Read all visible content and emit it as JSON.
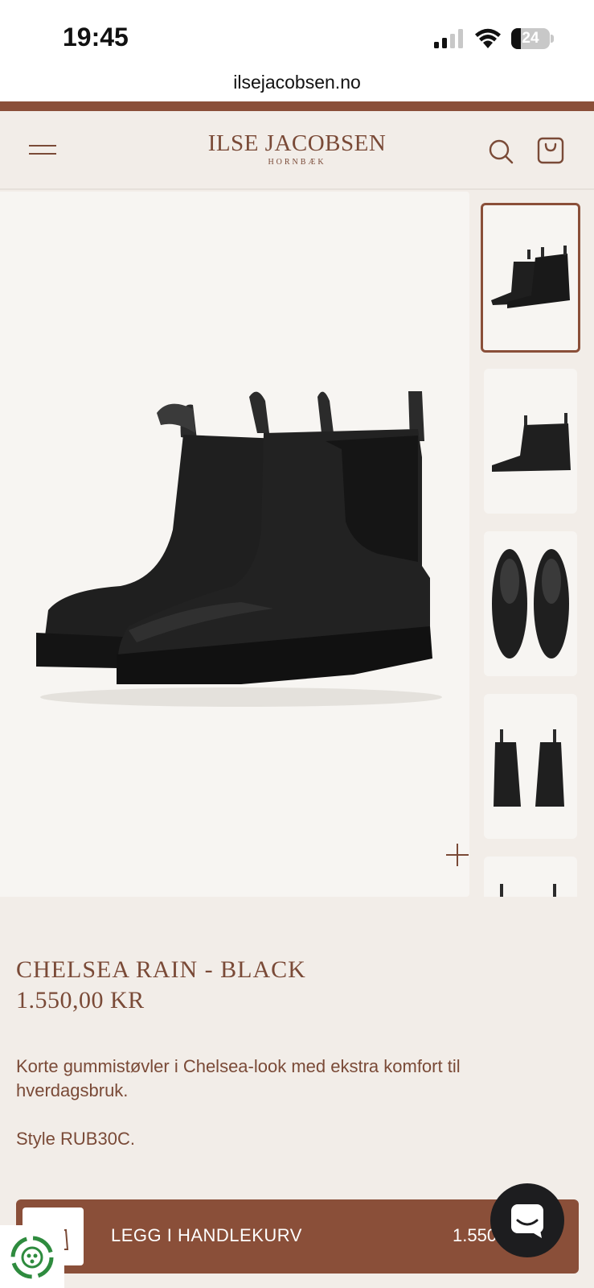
{
  "status_bar": {
    "time": "19:45",
    "battery_level": "24",
    "battery_fraction": 0.24,
    "icons": [
      "signal-icon",
      "wifi-icon",
      "battery-icon"
    ]
  },
  "browser": {
    "url": "ilsejacobsen.no"
  },
  "header": {
    "brand_name": "ILSE JACOBSEN",
    "brand_location": "HORNBÆK",
    "icons": [
      "menu-icon",
      "search-icon",
      "bag-icon"
    ]
  },
  "gallery": {
    "main_image_alt": "Chelsea Rain black rubber boots",
    "thumbnail_count": 5,
    "active_thumbnail": 1
  },
  "product": {
    "title": "CHELSEA RAIN - BLACK",
    "price": "1.550,00 KR",
    "description": "Korte gummistøvler i Chelsea-look med ekstra komfort til hverdagsbruk.",
    "style": "Style RUB30C."
  },
  "add_to_cart": {
    "label": "LEGG I HANDLEKURV",
    "price": "1.550,"
  },
  "colors": {
    "brand": "#8a4f39",
    "text": "#7a4a37",
    "background": "#f2ede8"
  }
}
